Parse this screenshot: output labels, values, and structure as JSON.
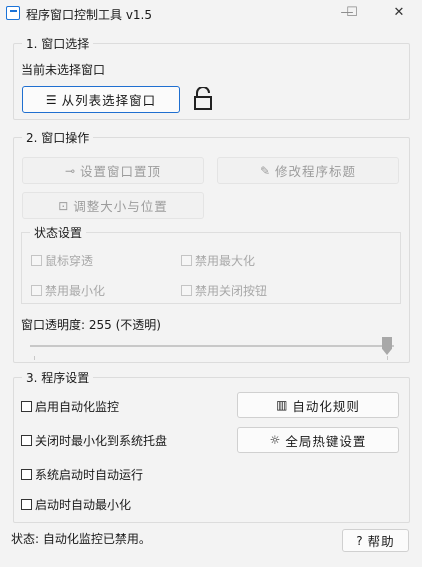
{
  "window": {
    "title": "程序窗口控制工具 v1.5",
    "minimize": "—",
    "maximize": "☐",
    "close": "✕"
  },
  "window_select": {
    "group_title": "1. 窗口选择",
    "status": "当前未选择窗口",
    "select_button": "从列表选择窗口"
  },
  "window_ops": {
    "group_title": "2. 窗口操作",
    "pin_top": "设置窗口置顶",
    "rename": "修改程序标题",
    "resize": "调整大小与位置",
    "state_title": "状态设置",
    "click_through": "鼠标穿透",
    "disable_maximize": "禁用最大化",
    "disable_minimize": "禁用最小化",
    "disable_close": "禁用关闭按钮",
    "opacity_label": "窗口透明度: 255 (不透明)",
    "opacity_value": 255,
    "opacity_max": 255
  },
  "program_settings": {
    "group_title": "3. 程序设置",
    "enable_automation": "启用自动化监控",
    "minimize_to_tray": "关闭时最小化到系统托盘",
    "autorun": "系统启动时自动运行",
    "start_minimized": "启动时自动最小化",
    "rules_button": "自动化规则",
    "hotkey_button": "全局热键设置"
  },
  "statusbar": {
    "text": "状态: 自动化监控已禁用。",
    "help_button": "帮助"
  },
  "icons": {
    "pin": "⊸",
    "pencil": "✎",
    "resize": "⊡",
    "book": "▥",
    "gear": "☼",
    "help": "?"
  }
}
